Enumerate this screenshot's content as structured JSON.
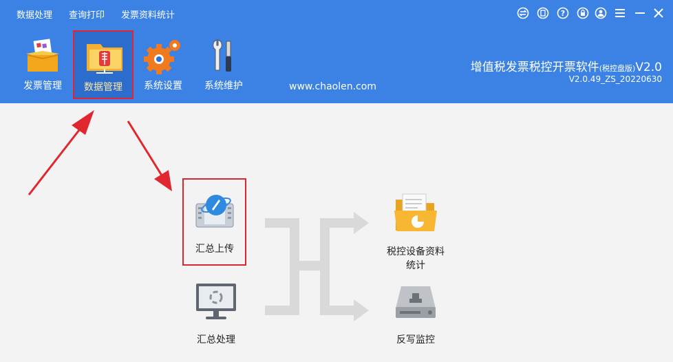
{
  "menu": {
    "items": [
      "数据处理",
      "查询打印",
      "发票资料统计"
    ]
  },
  "toolbar": {
    "items": [
      {
        "label": "发票管理",
        "icon": "invoice-box-icon"
      },
      {
        "label": "数据管理",
        "icon": "data-folder-icon"
      },
      {
        "label": "系统设置",
        "icon": "gear-icon"
      },
      {
        "label": "系统维护",
        "icon": "tools-icon"
      }
    ],
    "active": "数据管理"
  },
  "website": "www.chaolen.com",
  "app": {
    "title_main": "增值税发票税控开票软件",
    "title_sub": "(税控盘版)",
    "title_ver": "V2.0",
    "version": "V2.0.49_ZS_20220630"
  },
  "window_controls": [
    "swap-icon",
    "document-icon",
    "help-icon",
    "lock-icon",
    "user-icon",
    "hamburger-icon",
    "minimize-icon",
    "close-icon"
  ],
  "functions": {
    "upload": {
      "label": "汇总上传",
      "icon": "upload-monitor-icon"
    },
    "process": {
      "label": "汇总处理",
      "icon": "process-monitor-icon"
    },
    "stats_line1": "税控设备资料",
    "stats_line2": "统计",
    "stats_icon": "stats-folder-icon",
    "monitor": {
      "label": "反写监控",
      "icon": "disk-drive-icon"
    }
  },
  "colors": {
    "header": "#3b82e4",
    "highlight": "#e0262e",
    "background": "#f3f3f3",
    "flow": "#d9d9d9"
  }
}
